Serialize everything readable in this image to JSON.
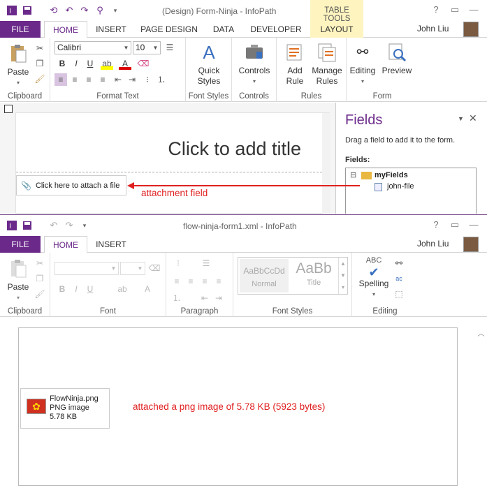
{
  "w1": {
    "title": "(Design) Form-Ninja - InfoPath",
    "contextual_group": "TABLE TOOLS",
    "tabs": [
      "FILE",
      "HOME",
      "INSERT",
      "PAGE DESIGN",
      "DATA",
      "DEVELOPER",
      "LAYOUT"
    ],
    "active_tab": "HOME",
    "user": "John Liu",
    "ribbon": {
      "clipboard": {
        "paste": "Paste",
        "label": "Clipboard"
      },
      "format_text": {
        "font": "Calibri",
        "size": "10",
        "bold": "B",
        "italic": "I",
        "underline": "U",
        "label": "Format Text"
      },
      "font_styles": {
        "quick_styles_1": "Quick",
        "quick_styles_2": "Styles",
        "label": "Font Styles"
      },
      "controls": {
        "controls": "Controls",
        "label": "Controls"
      },
      "rules": {
        "add_rule_1": "Add",
        "add_rule_2": "Rule",
        "manage_rules_1": "Manage",
        "manage_rules_2": "Rules",
        "label": "Rules"
      },
      "form": {
        "editing": "Editing",
        "preview": "Preview",
        "label": "Form"
      }
    },
    "canvas": {
      "title_placeholder": "Click to add title",
      "attach_button": "Click here to attach a file"
    },
    "fields_panel": {
      "title": "Fields",
      "instruction": "Drag a field to add it to the form.",
      "fields_label": "Fields:",
      "tree": [
        {
          "name": "myFields",
          "toggle": "⊟"
        },
        {
          "name": "john-file"
        }
      ]
    },
    "annotation": "attachment field",
    "accent": "#6b2a8a"
  },
  "w2": {
    "title": "flow-ninja-form1.xml - InfoPath",
    "tabs": [
      "FILE",
      "HOME",
      "INSERT"
    ],
    "active_tab": "HOME",
    "user": "John Liu",
    "ribbon": {
      "clipboard": {
        "paste": "Paste",
        "label": "Clipboard"
      },
      "font": {
        "bold": "B",
        "italic": "I",
        "underline": "U",
        "label": "Font"
      },
      "paragraph": {
        "label": "Paragraph"
      },
      "font_styles": {
        "normal_sample": "AaBbCcDd",
        "normal": "Normal",
        "title_sample": "AaBb",
        "title": "Title",
        "label": "Font Styles"
      },
      "editing": {
        "spelling_abc": "ABC",
        "spelling": "Spelling",
        "label": "Editing"
      }
    },
    "attachment": {
      "name": "FlowNinja.png",
      "type": "PNG image",
      "size": "5.78 KB"
    },
    "annotation": "attached a png image of 5.78 KB (5923 bytes)"
  }
}
